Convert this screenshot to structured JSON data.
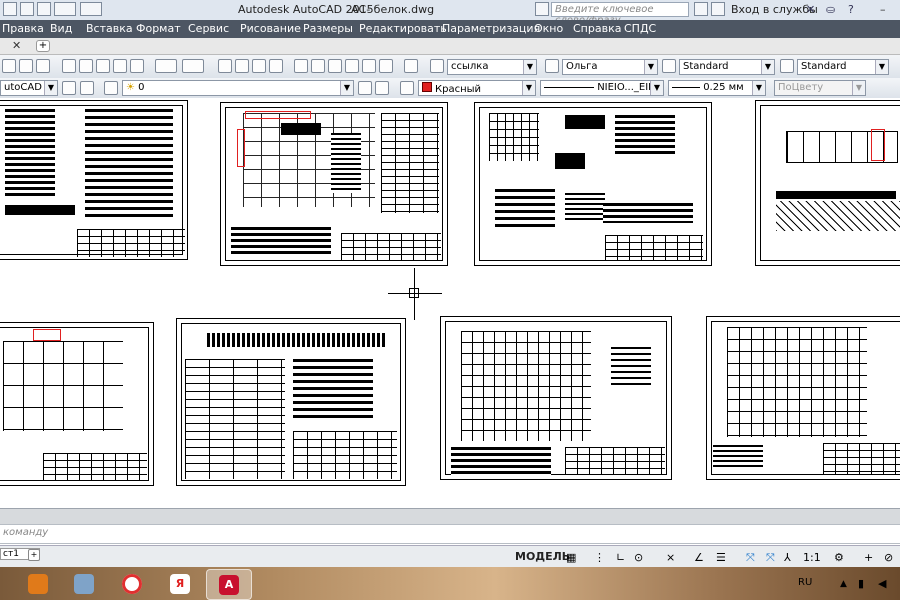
{
  "title_bar": {
    "app_title": "Autodesk AutoCAD 2015",
    "document_title": "АС- белок.dwg",
    "search_placeholder": "Введите ключевое слово/фразу",
    "signin_label": "Вход в службы"
  },
  "menu": {
    "items": [
      "Правка",
      "Вид",
      "Вставка",
      "Формат",
      "Сервис",
      "Рисование",
      "Размеры",
      "Редактировать",
      "Параметризация",
      "Окно",
      "Справка",
      "СПДС"
    ]
  },
  "toolbar1": {
    "text_style": "ссылка",
    "dim_style": "Ольга",
    "table_style": "Standard",
    "mleader_style": "Standard"
  },
  "toolbar2": {
    "workspace": "utoCAD",
    "layer": "0",
    "color": "Красный",
    "linetype": "NIEIO..._EIIEY_",
    "lineweight": "0.25 мм",
    "plot_style": "ПоЦвету"
  },
  "command": {
    "prompt": "команду"
  },
  "layout": {
    "tab_label": "ст1"
  },
  "status": {
    "model_label": "МОДЕЛЬ",
    "scale": "1:1"
  },
  "taskbar": {
    "lang": "RU"
  },
  "colors": {
    "menu_bg": "#4d5663",
    "layer_color": "#e02020",
    "taskbar_accent": "#d8b48a"
  }
}
